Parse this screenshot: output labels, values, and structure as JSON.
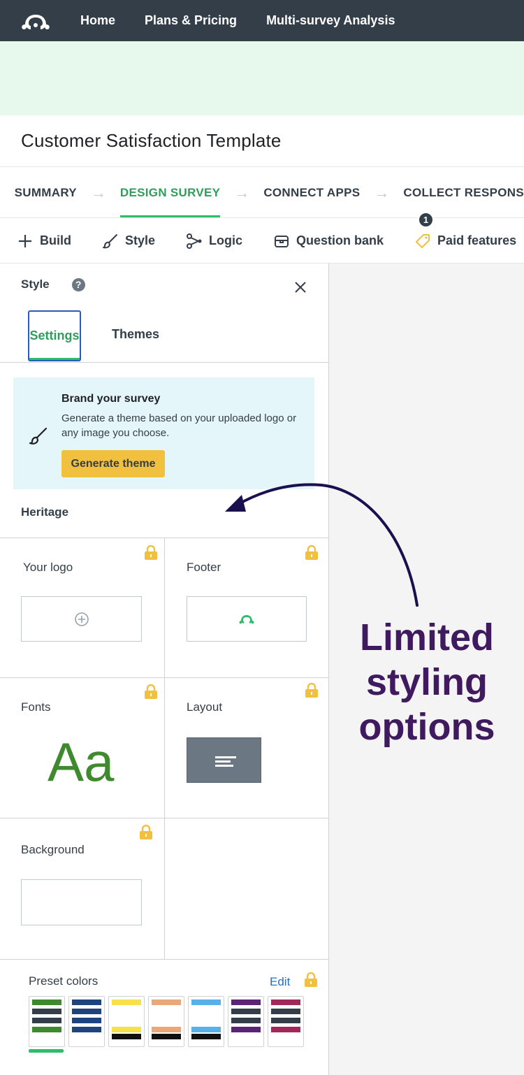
{
  "topnav": {
    "logo_icon": "surveymonkey-logo",
    "links": [
      "Home",
      "Plans & Pricing",
      "Multi-survey Analysis"
    ]
  },
  "survey": {
    "title": "Customer Satisfaction Template"
  },
  "steps": [
    "SUMMARY",
    "DESIGN SURVEY",
    "CONNECT APPS",
    "COLLECT RESPONS"
  ],
  "toolbar": {
    "build": "Build",
    "style": "Style",
    "logic": "Logic",
    "question_bank": "Question bank",
    "paid_features": "Paid features",
    "paid_badge": "1"
  },
  "panel": {
    "title": "Style",
    "help": "?",
    "tabs": {
      "settings": "Settings",
      "themes": "Themes"
    },
    "brand": {
      "title": "Brand your survey",
      "description": "Generate a theme based on your uploaded logo or any image you choose.",
      "button": "Generate theme"
    },
    "theme_name": "Heritage",
    "cells": {
      "logo": "Your logo",
      "footer": "Footer",
      "fonts": "Fonts",
      "fonts_sample": "Aa",
      "layout": "Layout",
      "background": "Background"
    },
    "preset": {
      "label": "Preset colors",
      "edit": "Edit"
    }
  },
  "annotation": {
    "lines": [
      "Limited",
      "styling",
      "options"
    ]
  },
  "colors": {
    "nav_bg": "#333e48",
    "accent_green": "#2ebd6b",
    "lock_yellow": "#f2c03f",
    "annotation_purple": "#3f1a5e"
  }
}
